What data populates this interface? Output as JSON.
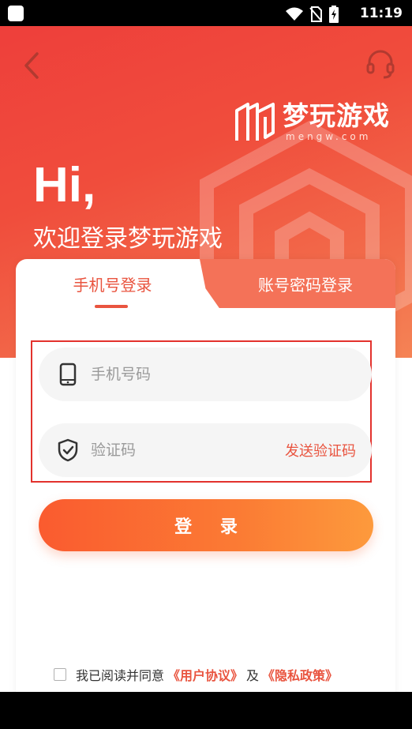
{
  "status_bar": {
    "time": "11:19",
    "icons": [
      "wifi-icon",
      "no-sim-icon",
      "battery-charging-icon"
    ]
  },
  "header": {
    "back_icon": "chevron-left-icon",
    "support_icon": "headset-icon"
  },
  "brand": {
    "name": "梦玩游戏",
    "domain": "mengw.com"
  },
  "hero": {
    "greeting": "Hi,",
    "welcome": "欢迎登录梦玩游戏"
  },
  "tabs": [
    {
      "label": "手机号登录",
      "active": true
    },
    {
      "label": "账号密码登录",
      "active": false
    }
  ],
  "form": {
    "phone_placeholder": "手机号码",
    "phone_value": "",
    "code_placeholder": "验证码",
    "code_value": "",
    "send_code_label": "发送验证码",
    "login_label": "登 录"
  },
  "agreement": {
    "text": "我已阅读并同意",
    "user_agreement": "《用户协议》",
    "conjunction": "及",
    "privacy_policy": "《隐私政策》",
    "checked": false
  },
  "colors": {
    "accent": "#e9543f",
    "highlight_border": "#e3322d",
    "button_start": "#fa5b2f",
    "button_end": "#fd9a3c"
  }
}
